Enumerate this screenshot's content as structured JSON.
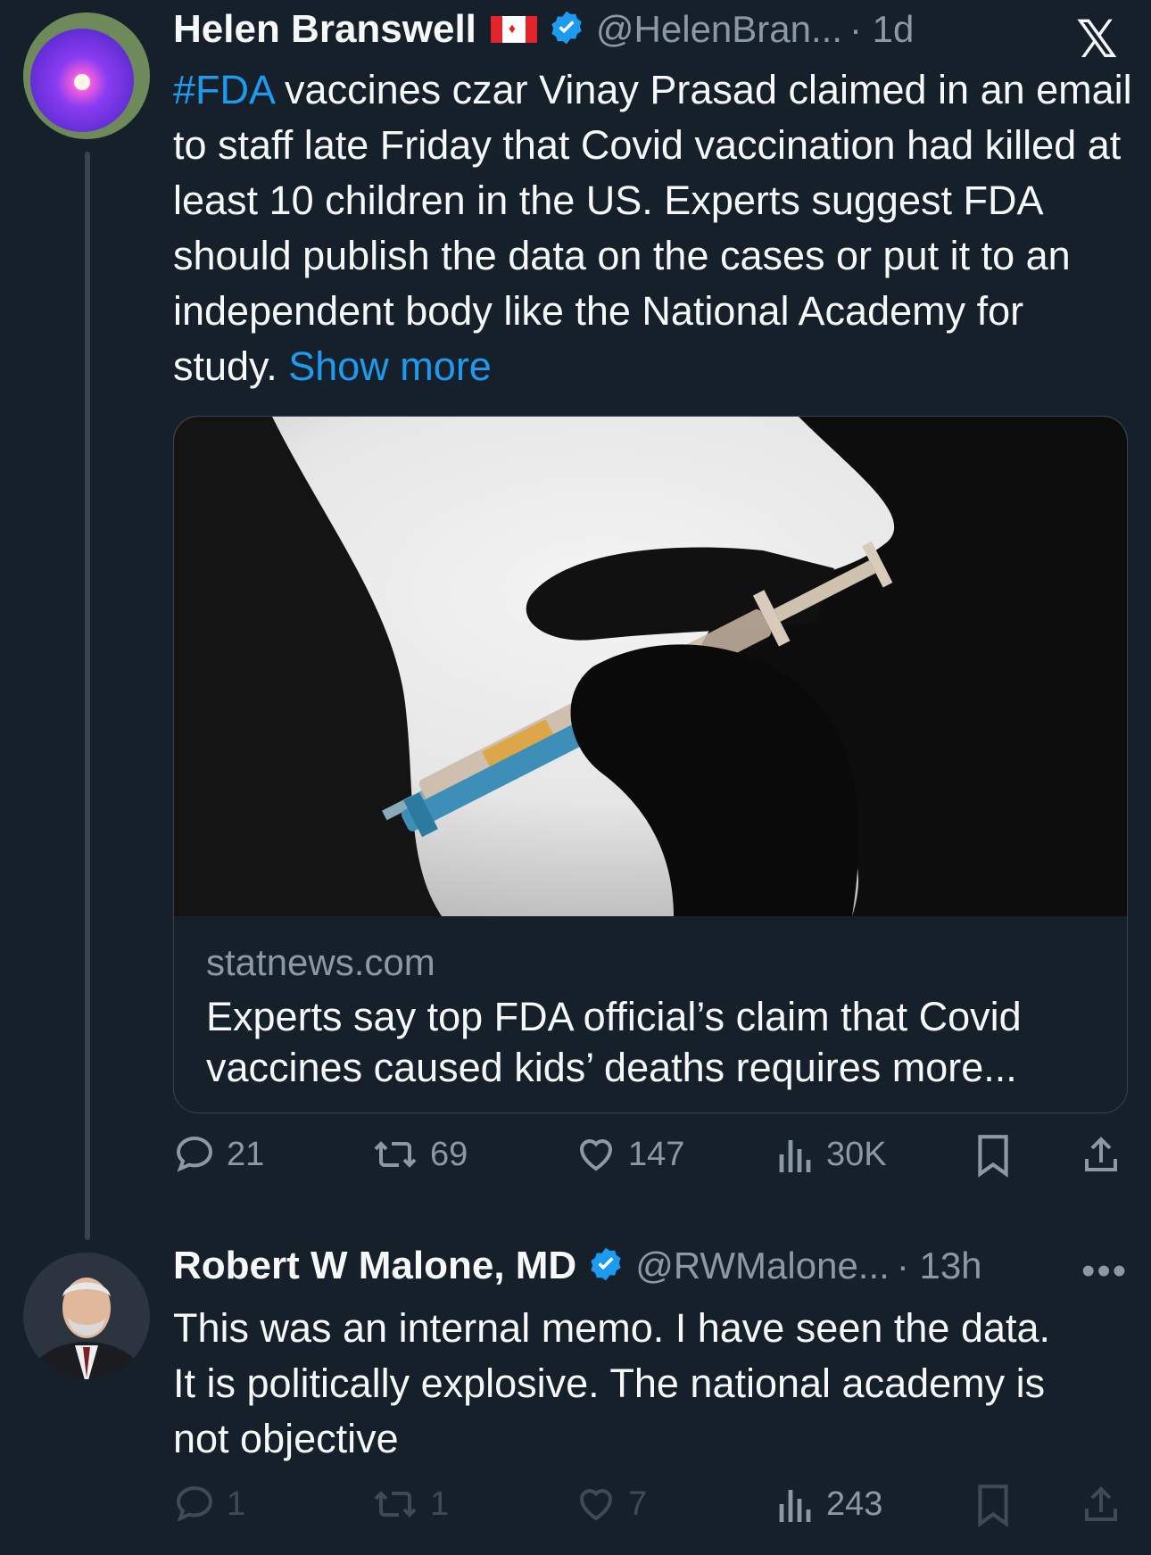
{
  "tweet1": {
    "name": "Helen Branswell",
    "flag_label": "Canada flag",
    "handle": "@HelenBran...",
    "time": "· 1d",
    "hashtag": "#FDA",
    "text": " vaccines czar Vinay Prasad claimed in an email to staff late Friday that Covid vaccination had killed at least 10 children in the US. Experts suggest FDA should publish the data on the cases or put it to an independent body like the National Academy for study. ",
    "show_more": "Show more",
    "card": {
      "domain": "statnews.com",
      "title": "Experts say top FDA official’s claim that Covid vaccines caused kids’ deaths requires more..."
    },
    "actions": {
      "replies": "21",
      "reposts": "69",
      "likes": "147",
      "views": "30K"
    }
  },
  "tweet2": {
    "name": "Robert W Malone, MD",
    "handle": "@RWMalone...",
    "time": "· 13h",
    "text": "This was an internal memo.  I have seen the data.  It is politically explosive.  The national academy is not objective",
    "more": "•••",
    "actions": {
      "replies": "1",
      "reposts": "1",
      "likes": "7",
      "views": "243"
    }
  },
  "x_logo": "𝕏",
  "colors": {
    "background": "#15202b",
    "link": "#1d9bf0",
    "verified": "#1d9bf0",
    "secondary_text": "#8b98a5"
  }
}
